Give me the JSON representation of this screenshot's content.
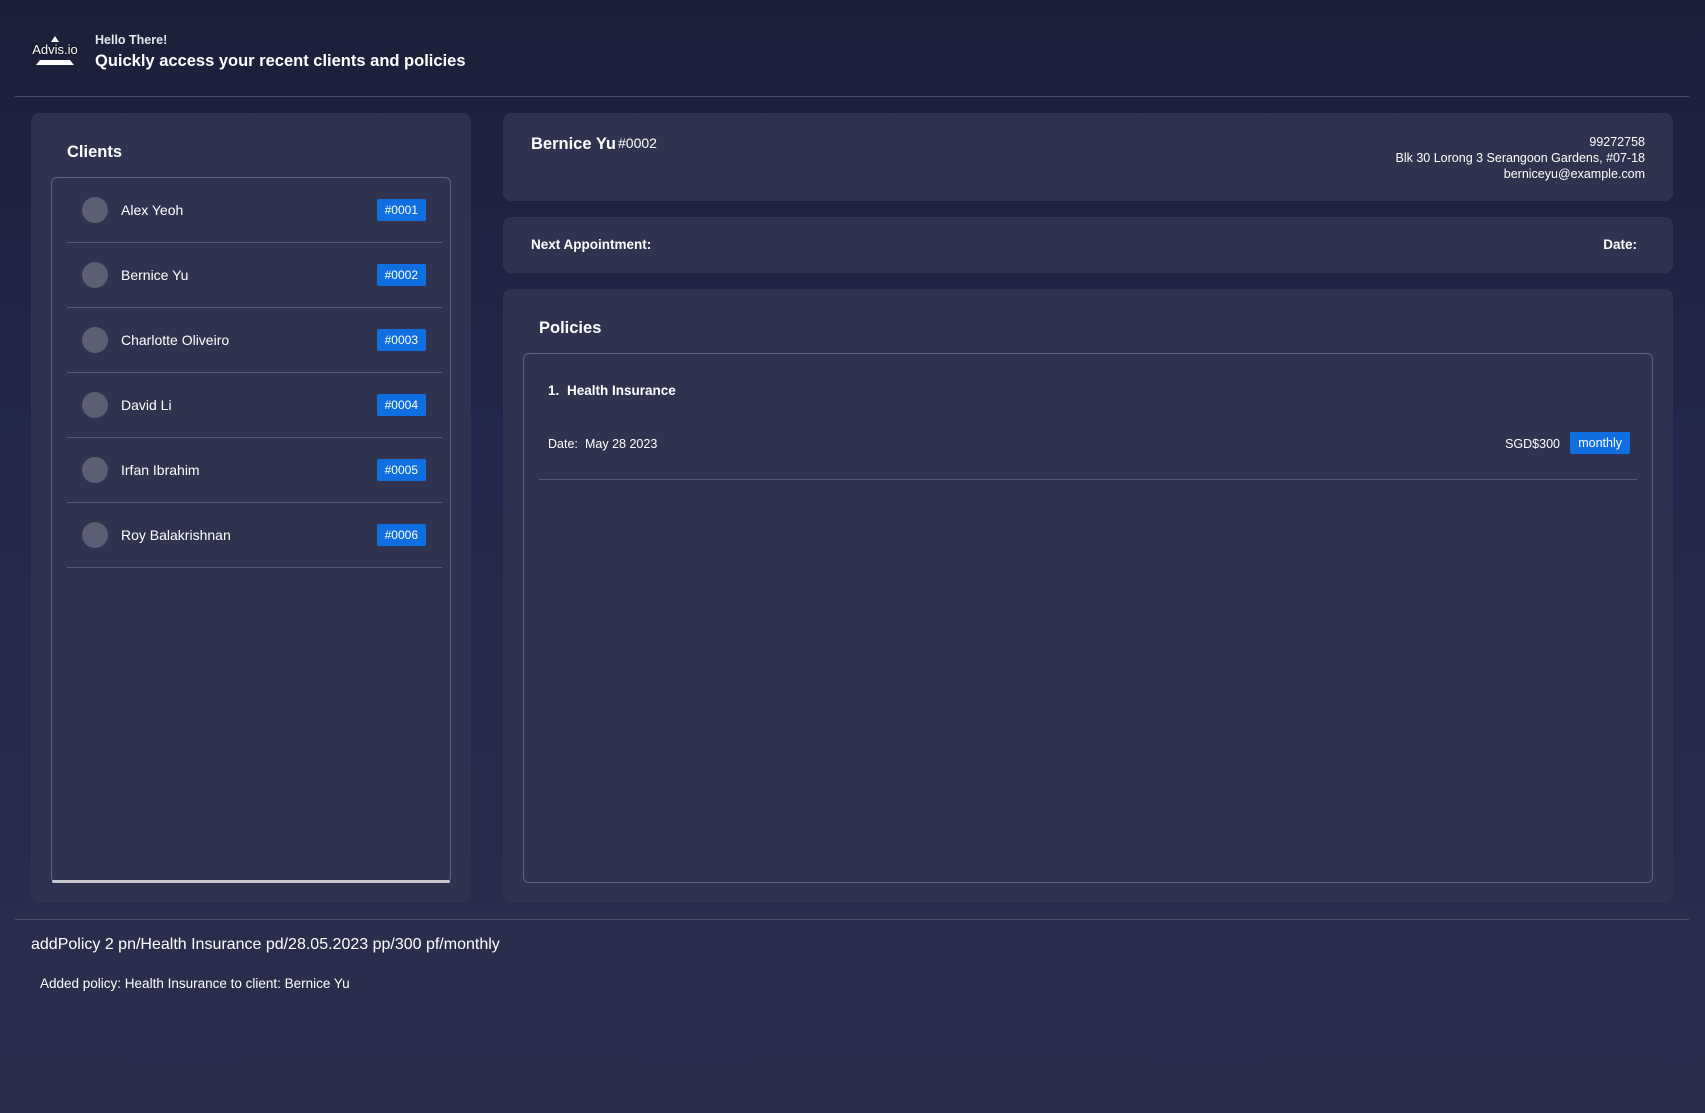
{
  "header": {
    "logo_text": "Advis.io",
    "greeting": "Hello There!",
    "subtitle": "Quickly access your recent clients and policies"
  },
  "clients": {
    "title": "Clients",
    "items": [
      {
        "name": "Alex Yeoh",
        "id": "#0001"
      },
      {
        "name": "Bernice Yu",
        "id": "#0002"
      },
      {
        "name": "Charlotte Oliveiro",
        "id": "#0003"
      },
      {
        "name": "David Li",
        "id": "#0004"
      },
      {
        "name": "Irfan Ibrahim",
        "id": "#0005"
      },
      {
        "name": "Roy Balakrishnan",
        "id": "#0006"
      }
    ]
  },
  "selected_client": {
    "name": "Bernice Yu",
    "id": "#0002",
    "phone": "99272758",
    "address": "Blk 30 Lorong 3 Serangoon Gardens, #07-18",
    "email": "berniceyu@example.com"
  },
  "appointment": {
    "next_label": "Next Appointment:",
    "date_label": "Date:"
  },
  "policies": {
    "title": "Policies",
    "items": [
      {
        "index": "1.",
        "name": "Health Insurance",
        "date_label": "Date:",
        "date": "May 28 2023",
        "premium": "SGD$300",
        "frequency": "monthly"
      }
    ]
  },
  "command": {
    "value": "addPolicy 2 pn/Health Insurance pd/28.05.2023 pp/300 pf/monthly",
    "result": "Added policy: Health Insurance to client: Bernice Yu"
  },
  "colors": {
    "accent": "#0f6fe0",
    "panel": "#30334f"
  }
}
